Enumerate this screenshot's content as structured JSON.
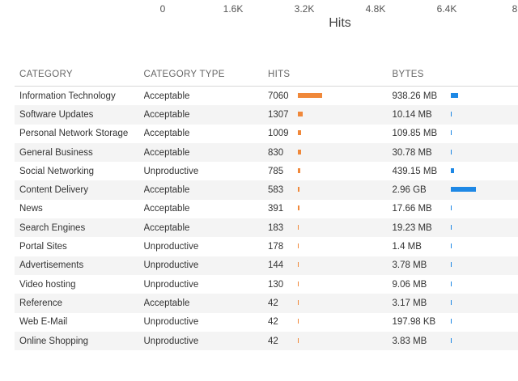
{
  "axis": {
    "ticks": [
      "0",
      "1.6K",
      "3.2K",
      "4.8K",
      "6.4K",
      "8"
    ],
    "title": "Hits"
  },
  "table": {
    "headers": {
      "category": "CATEGORY",
      "category_type": "CATEGORY TYPE",
      "hits": "HITS",
      "bytes": "BYTES"
    },
    "rows": [
      {
        "category": "Information Technology",
        "category_type": "Acceptable",
        "hits": "7060",
        "hits_value": 7060,
        "bytes": "938.26 MB",
        "bytes_mb": 938.26
      },
      {
        "category": "Software Updates",
        "category_type": "Acceptable",
        "hits": "1307",
        "hits_value": 1307,
        "bytes": "10.14 MB",
        "bytes_mb": 10.14
      },
      {
        "category": "Personal Network Storage",
        "category_type": "Acceptable",
        "hits": "1009",
        "hits_value": 1009,
        "bytes": "109.85 MB",
        "bytes_mb": 109.85
      },
      {
        "category": "General Business",
        "category_type": "Acceptable",
        "hits": "830",
        "hits_value": 830,
        "bytes": "30.78 MB",
        "bytes_mb": 30.78
      },
      {
        "category": "Social Networking",
        "category_type": "Unproductive",
        "hits": "785",
        "hits_value": 785,
        "bytes": "439.15 MB",
        "bytes_mb": 439.15
      },
      {
        "category": "Content Delivery",
        "category_type": "Acceptable",
        "hits": "583",
        "hits_value": 583,
        "bytes": "2.96 GB",
        "bytes_mb": 3031.04
      },
      {
        "category": "News",
        "category_type": "Acceptable",
        "hits": "391",
        "hits_value": 391,
        "bytes": "17.66 MB",
        "bytes_mb": 17.66
      },
      {
        "category": "Search Engines",
        "category_type": "Acceptable",
        "hits": "183",
        "hits_value": 183,
        "bytes": "19.23 MB",
        "bytes_mb": 19.23
      },
      {
        "category": "Portal Sites",
        "category_type": "Unproductive",
        "hits": "178",
        "hits_value": 178,
        "bytes": "1.4 MB",
        "bytes_mb": 1.4
      },
      {
        "category": "Advertisements",
        "category_type": "Unproductive",
        "hits": "144",
        "hits_value": 144,
        "bytes": "3.78 MB",
        "bytes_mb": 3.78
      },
      {
        "category": "Video hosting",
        "category_type": "Unproductive",
        "hits": "130",
        "hits_value": 130,
        "bytes": "9.06 MB",
        "bytes_mb": 9.06
      },
      {
        "category": "Reference",
        "category_type": "Acceptable",
        "hits": "42",
        "hits_value": 42,
        "bytes": "3.17 MB",
        "bytes_mb": 3.17
      },
      {
        "category": "Web E-Mail",
        "category_type": "Unproductive",
        "hits": "42",
        "hits_value": 42,
        "bytes": "197.98 KB",
        "bytes_mb": 0.19
      },
      {
        "category": "Online Shopping",
        "category_type": "Unproductive",
        "hits": "42",
        "hits_value": 42,
        "bytes": "3.83 MB",
        "bytes_mb": 3.83
      }
    ]
  },
  "colors": {
    "hits_bar": "#f0883a",
    "bytes_bar": "#1e88e5"
  }
}
